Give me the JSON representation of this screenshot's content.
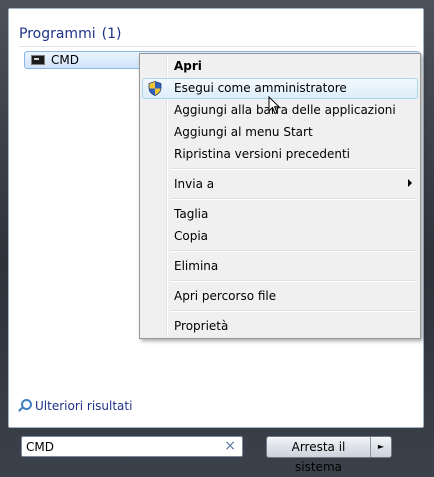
{
  "results": {
    "section_title": "Programmi",
    "section_count": "(1)",
    "item_label": "CMD",
    "more_results": "Ulteriori risultati"
  },
  "search": {
    "value": "CMD",
    "clear_glyph": "×"
  },
  "shutdown": {
    "label": "Arresta il sistema",
    "arrow_glyph": "►"
  },
  "context_menu": {
    "items": [
      {
        "label": "Apri"
      },
      {
        "label": "Esegui come amministratore"
      },
      {
        "label": "Aggiungi alla barra delle applicazioni"
      },
      {
        "label": "Aggiungi al menu Start"
      },
      {
        "label": "Ripristina versioni precedenti"
      },
      {
        "label": "Invia a"
      },
      {
        "label": "Taglia"
      },
      {
        "label": "Copia"
      },
      {
        "label": "Elimina"
      },
      {
        "label": "Apri percorso file"
      },
      {
        "label": "Proprietà"
      }
    ]
  },
  "colors": {
    "link_blue": "#1e3287",
    "menu_background": "#f0f0f0",
    "highlight_border": "#a8d8eb"
  }
}
